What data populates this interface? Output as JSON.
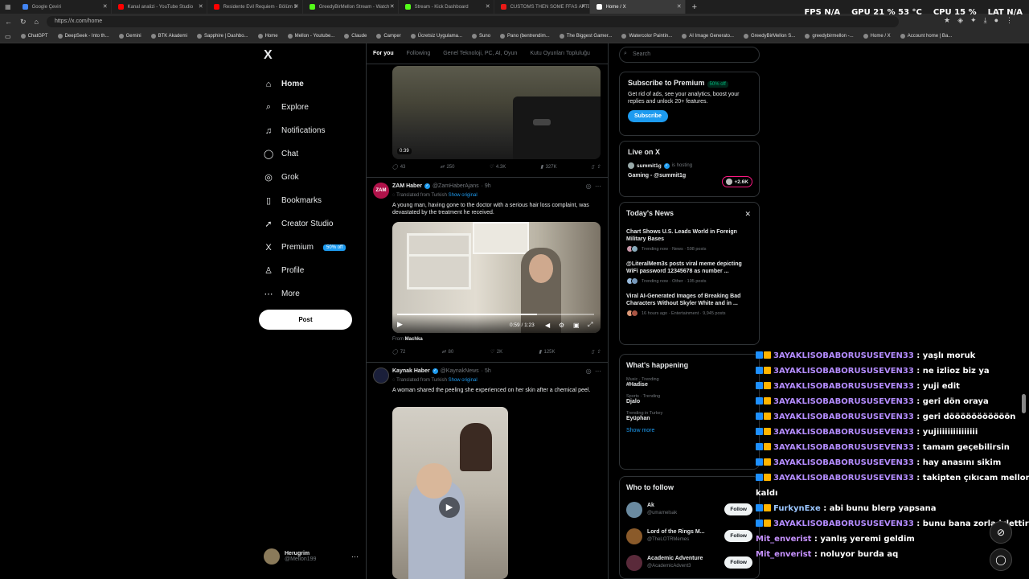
{
  "browser": {
    "tabs": [
      {
        "label": "Google Çeviri",
        "color": "#4285f4",
        "active": false
      },
      {
        "label": "Kanal analizi - YouTube Studio",
        "color": "#ff0000",
        "active": false
      },
      {
        "label": "Residente Evil Requiem - Bölüm 5",
        "color": "#ff0000",
        "active": false
      },
      {
        "label": "GreedyBirMellon Stream - Watch",
        "color": "#53fc18",
        "active": false
      },
      {
        "label": "Stream - Kick Dashboard",
        "color": "#53fc18",
        "active": false
      },
      {
        "label": "CUSTOMS THEN SOME FFAS AFTER",
        "color": "#e91916",
        "active": false
      },
      {
        "label": "Home / X",
        "color": "#ffffff",
        "active": true
      }
    ],
    "url": "https://x.com/home",
    "bookmarks": [
      "ChatGPT",
      "DeepSeek - Into th...",
      "Gemini",
      "BTK Akademi",
      "Sapphire | Dashbo...",
      "Home",
      "Mellon - Youtube...",
      "Claude",
      "Camper",
      "Ücretsiz Uygulama...",
      "Suno",
      "Pano (bentrendim...",
      "The Biggest Gamer...",
      "Watercolor Paintin...",
      "AI Image Generato...",
      "GreedyBirMellon S...",
      "greedybirmellon -...",
      "Home / X",
      "Account home | Ba..."
    ]
  },
  "hud": {
    "fps_label": "FPS",
    "fps_value": "N/A",
    "gpu_label": "GPU",
    "gpu_value": "21 % 53 °C",
    "cpu_label": "CPU",
    "cpu_value": "15 %",
    "lat_label": "LAT",
    "lat_value": "N/A"
  },
  "nav": {
    "items": [
      {
        "label": "Home",
        "icon": "home-icon",
        "glyph": "⌂"
      },
      {
        "label": "Explore",
        "icon": "search-icon",
        "glyph": "⌕"
      },
      {
        "label": "Notifications",
        "icon": "bell-icon",
        "glyph": "♫"
      },
      {
        "label": "Chat",
        "icon": "chat-icon",
        "glyph": "◯"
      },
      {
        "label": "Grok",
        "icon": "grok-icon",
        "glyph": "◎"
      },
      {
        "label": "Bookmarks",
        "icon": "bookmark-icon",
        "glyph": "▯"
      },
      {
        "label": "Creator Studio",
        "icon": "rocket-icon",
        "glyph": "➚"
      },
      {
        "label": "Premium",
        "icon": "x-logo-icon",
        "glyph": "X"
      },
      {
        "label": "Profile",
        "icon": "person-icon",
        "glyph": "♙"
      },
      {
        "label": "More",
        "icon": "more-icon",
        "glyph": "⋯"
      }
    ],
    "premium_badge": "50% off",
    "post_label": "Post",
    "logo": "X"
  },
  "account": {
    "name": "Herugrim",
    "handle": "@Mellon199"
  },
  "feed": {
    "tabs": [
      "For you",
      "Following",
      "Genel Teknoloji, PC, AI, Oyun",
      "Kutu Oyunları Topluluğu"
    ],
    "post1": {
      "duration": "0:39",
      "replies": "43",
      "reposts": "250",
      "likes": "4.3K",
      "views": "327K"
    },
    "post2": {
      "name": "ZAM Haber",
      "handle": "@ZamHaberAjans",
      "time": "· 9h",
      "translated": "Translated from Turkish",
      "show_original": "Show original",
      "text": "A young man, having gone to the doctor with a serious hair loss complaint, was devastated by the treatment he received.",
      "video_time": "0:59 / 1:23",
      "from_label": "From",
      "from_source": "Machka",
      "replies": "72",
      "reposts": "80",
      "likes": "2K",
      "views": "125K"
    },
    "post3": {
      "name": "Kaynak Haber",
      "handle": "@KaynakNews",
      "time": "· 5h",
      "translated": "Translated from Turkish",
      "show_original": "Show original",
      "text": "A woman shared the peeling she experienced on her skin after a chemical peel."
    }
  },
  "sidebar": {
    "search_placeholder": "Search",
    "premium": {
      "title": "Subscribe to Premium",
      "badge": "50% off",
      "text": "Get rid of ads, see your analytics, boost your replies and unlock 20+ features.",
      "button": "Subscribe"
    },
    "live": {
      "title": "Live on X",
      "host": "summit1g",
      "status": "is hosting",
      "event": "Gaming - @summit1g",
      "count": "+2.6K"
    },
    "news": {
      "title": "Today's News",
      "items": [
        {
          "title": "Chart Shows U.S. Leads World in Foreign Military Bases",
          "meta": "Trending now · News · 598 posts"
        },
        {
          "title": "@LiteralMem3s posts viral meme depicting WiFi password 12345678 as number ...",
          "meta": "Trending now · Other · 195 posts"
        },
        {
          "title": "Viral AI-Generated Images of Breaking Bad Characters Without Skyler White and in ...",
          "meta": "16 hours ago · Entertainment · 9,945 posts"
        }
      ]
    },
    "happening": {
      "title": "What's happening",
      "items": [
        {
          "context": "Music · Trending",
          "topic": "#Hadise"
        },
        {
          "context": "Sports · Trending",
          "topic": "Djalo"
        },
        {
          "context": "Trending in Turkey",
          "topic": "Eyüphan"
        }
      ],
      "show_more": "Show more"
    },
    "who_to_follow": {
      "title": "Who to follow",
      "items": [
        {
          "name": "Ak",
          "handle": "@umarnelsak",
          "button": "Follow"
        },
        {
          "name": "Lord of the Rings M...",
          "handle": "@TheLOTRMemes",
          "button": "Follow"
        },
        {
          "name": "Academic Adventure",
          "handle": "@AcademicAdvent3",
          "button": "Follow"
        }
      ]
    }
  },
  "chat_overlay": {
    "messages": [
      {
        "user": "3AYAKLISOBABORUSUSEVEN33",
        "text": " : yaşlı moruk",
        "style": "u1",
        "badges": true
      },
      {
        "user": "3AYAKLISOBABORUSUSEVEN33",
        "text": " : ne izlioz biz ya",
        "style": "u1",
        "badges": true
      },
      {
        "user": "3AYAKLISOBABORUSUSEVEN33",
        "text": " : yuji edit",
        "style": "u1",
        "badges": true
      },
      {
        "user": "3AYAKLISOBABORUSUSEVEN33",
        "text": " : geri dön oraya",
        "style": "u1",
        "badges": true
      },
      {
        "user": "3AYAKLISOBABORUSUSEVEN33",
        "text": " : geri dööööööööööön",
        "style": "u1",
        "badges": true
      },
      {
        "user": "3AYAKLISOBABORUSUSEVEN33",
        "text": " : yujiiiiiiiiiiiiiii",
        "style": "u1",
        "badges": true
      },
      {
        "user": "3AYAKLISOBABORUSUSEVEN33",
        "text": " : tamam geçebilirsin",
        "style": "u1",
        "badges": true
      },
      {
        "user": "3AYAKLISOBABORUSUSEVEN33",
        "text": " : hay anasını sikim",
        "style": "u1",
        "badges": true
      },
      {
        "user": "3AYAKLISOBABORUSUSEVEN33",
        "text": " : takipten çıkıcam mellon u az",
        "style": "u1",
        "badges": true
      },
      {
        "user": "",
        "text": "kaldı",
        "style": "u1",
        "badges": false
      },
      {
        "user": "FurkynExe",
        "text": " : abi bunu blerp yapsana",
        "style": "u3",
        "badges": true
      },
      {
        "user": "3AYAKLISOBABORUSUSEVEN33",
        "text": " : bunu bana zorla izlettirdi",
        "style": "u1",
        "badges": true
      },
      {
        "user": "Mit_enverist",
        "text": " : yanlış yeremi geldim",
        "style": "u2",
        "badges": false
      },
      {
        "user": "Mit_enverist",
        "text": " : noluyor burda aq",
        "style": "u2",
        "badges": false
      }
    ]
  }
}
